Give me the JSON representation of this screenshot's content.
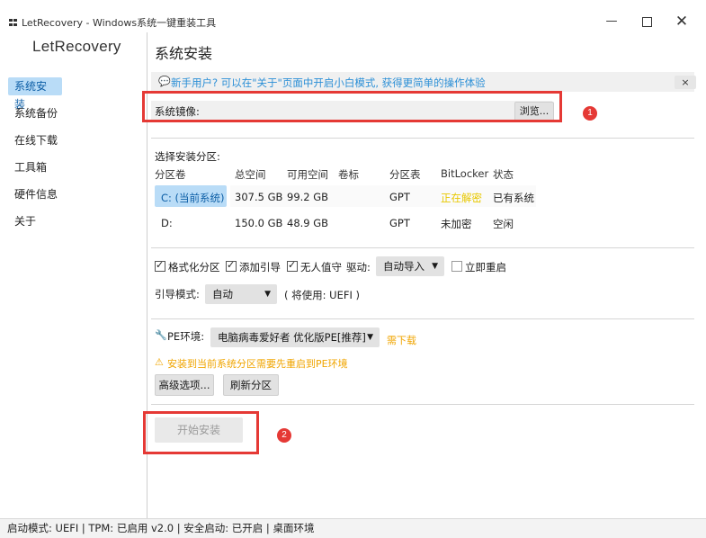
{
  "window": {
    "title": "LetRecovery - Windows系统一键重装工具",
    "minimize": "—",
    "close": "✕"
  },
  "sidebar": {
    "logo": "LetRecovery",
    "items": [
      {
        "label": "系统安装"
      },
      {
        "label": "系统备份"
      },
      {
        "label": "在线下载"
      },
      {
        "label": "工具箱"
      },
      {
        "label": "硬件信息"
      },
      {
        "label": "关于"
      }
    ]
  },
  "main": {
    "title": "系统安装",
    "hint": {
      "icon": "💬",
      "text": "新手用户? 可以在\"关于\"页面中开启小白模式, 获得更简单的操作体验",
      "close": "×"
    },
    "image": {
      "label": "系统镜像:",
      "value": "",
      "placeholder": "",
      "browse_label": "浏览..."
    },
    "partitions": {
      "title": "选择安装分区:",
      "headers": [
        "分区卷",
        "总空间",
        "可用空间",
        "卷标",
        "分区表",
        "BitLocker",
        "状态"
      ],
      "rows": [
        {
          "volume": "C: (当前系统)",
          "total": "307.5 GB",
          "free": "99.2 GB",
          "label": "",
          "table": "GPT",
          "bitlocker": "正在解密",
          "status": "已有系统"
        },
        {
          "volume": "D:",
          "total": "150.0 GB",
          "free": "48.9 GB",
          "label": "",
          "table": "GPT",
          "bitlocker": "未加密",
          "status": "空闲"
        }
      ]
    },
    "options": {
      "format": "格式化分区",
      "boot": "添加引导",
      "unattended": "无人值守",
      "driver_label": "驱动:",
      "driver_value": "自动导入",
      "reboot": "立即重启",
      "boot_mode_label": "引导模式:",
      "boot_mode_value": "自动",
      "boot_mode_note": "( 将使用: UEFI )"
    },
    "pe": {
      "icon": "wrench-icon",
      "label": "PE环境:",
      "value": "电脑病毒爱好者 优化版PE[推荐]",
      "download": "需下载",
      "warning_icon": "⚠",
      "warning": "安装到当前系统分区需要先重启到PE环境",
      "advanced": "高级选项...",
      "refresh": "刷新分区"
    },
    "start_label": "开始安装"
  },
  "annotations": {
    "one": "1",
    "two": "2"
  },
  "statusbar": {
    "text": "启动模式: UEFI | TPM: 已启用 v2.0 | 安全启动: 已开启 | 桌面环境"
  },
  "colors": {
    "accent": "#2b8fd6",
    "selected": "#b9dcf7",
    "warning": "#f0a500",
    "decrypting": "#e8c800",
    "annotation": "#e53935"
  }
}
